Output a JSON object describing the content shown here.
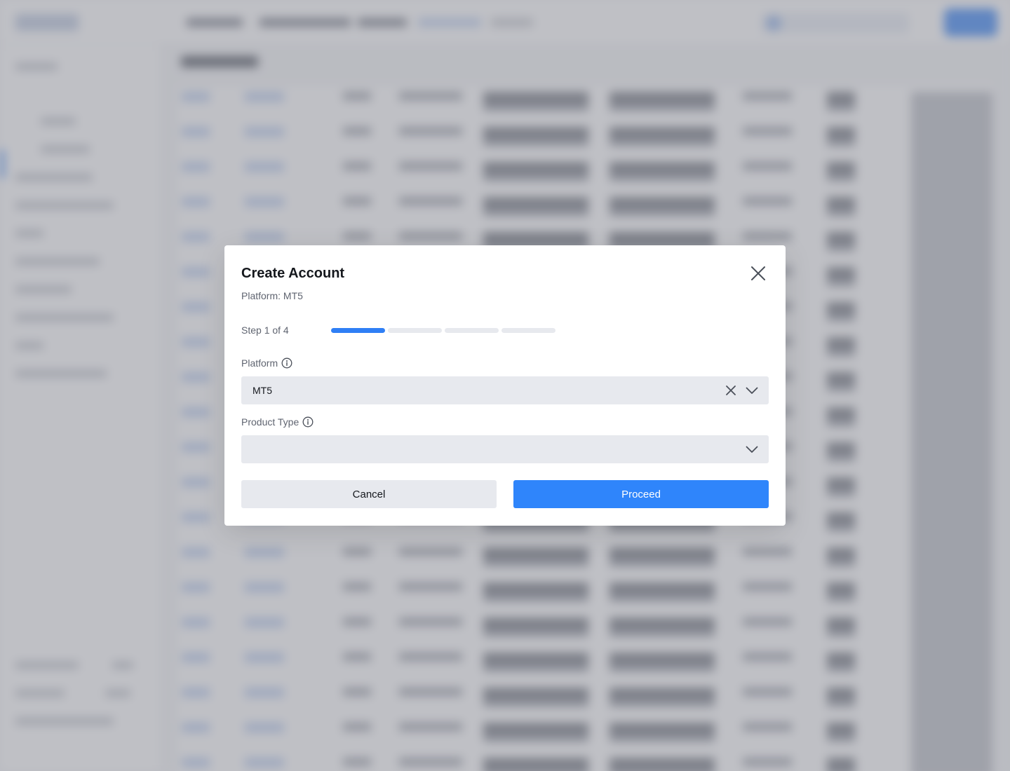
{
  "modal": {
    "title": "Create Account",
    "subtitle": "Platform: MT5",
    "close_icon": "close-icon"
  },
  "stepper": {
    "label": "Step 1 of 4",
    "current_step": 1,
    "total_steps": 4,
    "active_color": "#2f7ff5",
    "inactive_color": "#e7e9ee"
  },
  "fields": {
    "platform": {
      "label": "Platform",
      "value": "MT5",
      "icon": "info-icon"
    },
    "product_type": {
      "label": "Product Type",
      "value": "",
      "icon": "info-icon"
    }
  },
  "actions": {
    "cancel_label": "Cancel",
    "proceed_label": "Proceed",
    "proceed_color": "#2f85fb"
  }
}
